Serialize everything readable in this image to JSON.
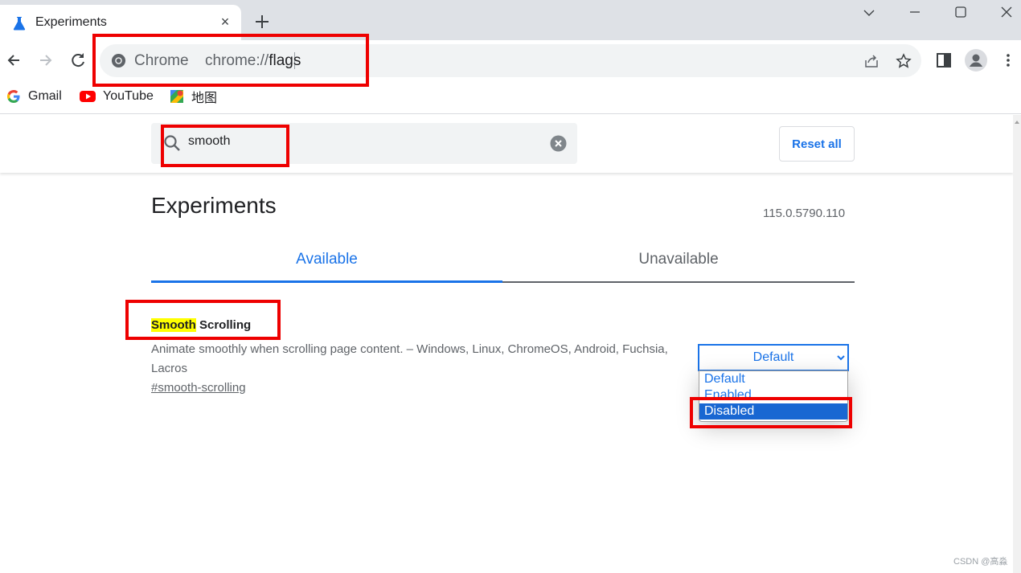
{
  "browser": {
    "tab": {
      "title": "Experiments",
      "close_glyph": "×",
      "favicon": "flask-icon"
    },
    "new_tab_glyph": "+",
    "window_controls": [
      "chevron-down-icon",
      "minimize-icon",
      "maximize-icon",
      "close-icon"
    ],
    "address_bar": {
      "chip": "Chrome",
      "url_prefix": "chrome://",
      "url_path": "flags"
    },
    "bookmarks": [
      {
        "label": "Gmail",
        "icon": "google-icon"
      },
      {
        "label": "YouTube",
        "icon": "youtube-icon"
      },
      {
        "label": "地图",
        "icon": "maps-icon"
      }
    ]
  },
  "page": {
    "search": {
      "value": "smooth"
    },
    "reset_label": "Reset all",
    "title": "Experiments",
    "version": "115.0.5790.110",
    "tabs": [
      {
        "label": "Available",
        "active": true
      },
      {
        "label": "Unavailable",
        "active": false
      }
    ],
    "experiment": {
      "name_highlight": "Smooth",
      "name_rest": " Scrolling",
      "description": "Animate smoothly when scrolling page content. – Windows, Linux, ChromeOS, Android, Fuchsia, Lacros",
      "link": "#smooth-scrolling",
      "select_value": "Default",
      "options": [
        "Default",
        "Enabled",
        "Disabled"
      ],
      "highlighted_option": "Disabled"
    }
  },
  "watermark": "CSDN @高淼",
  "colors": {
    "accent": "#1a73e8",
    "annotation": "#ee0000",
    "highlight": "#ffff00",
    "option_selected": "#1967d2"
  }
}
